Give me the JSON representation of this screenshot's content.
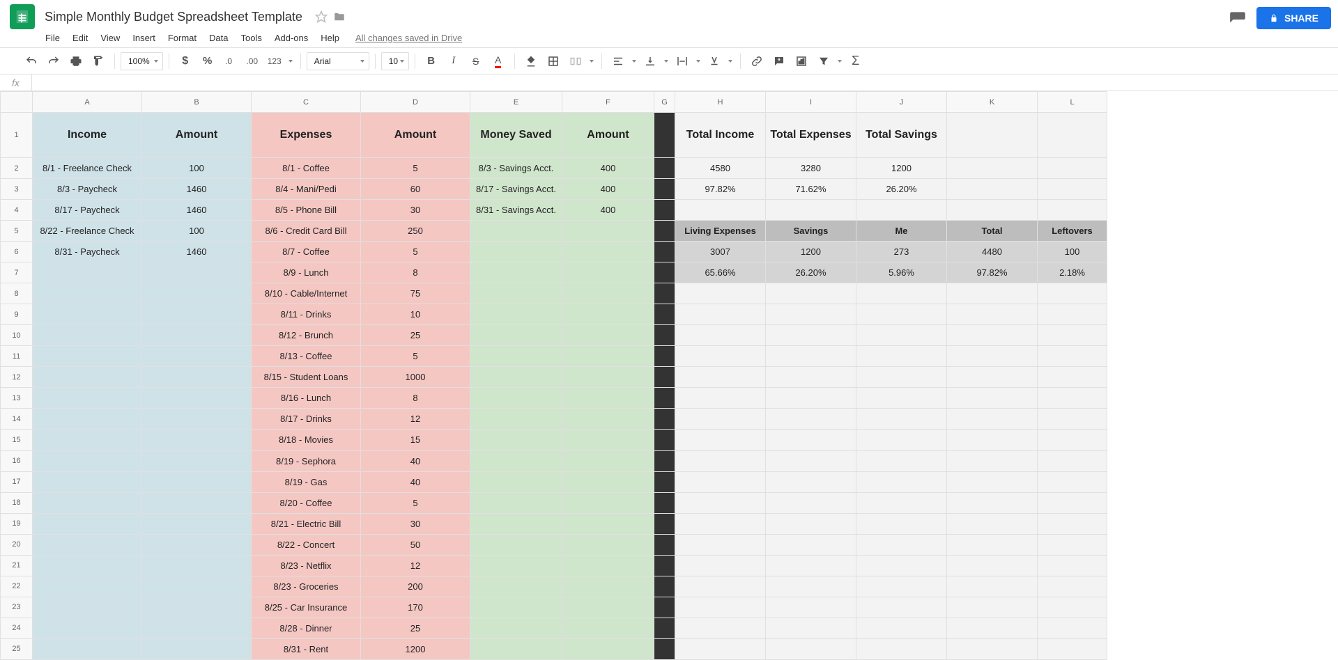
{
  "doc": {
    "title": "Simple Monthly Budget Spreadsheet Template",
    "save_status": "All changes saved in Drive"
  },
  "menu": [
    "File",
    "Edit",
    "View",
    "Insert",
    "Format",
    "Data",
    "Tools",
    "Add-ons",
    "Help"
  ],
  "toolbar": {
    "zoom": "100%",
    "font": "Arial",
    "size": "10"
  },
  "share": "SHARE",
  "cols": [
    "A",
    "B",
    "C",
    "D",
    "E",
    "F",
    "G",
    "H",
    "I",
    "J",
    "K",
    "L"
  ],
  "headers": {
    "income": "Income",
    "amount1": "Amount",
    "expenses": "Expenses",
    "amount2": "Amount",
    "saved": "Money Saved",
    "amount3": "Amount",
    "ti": "Total Income",
    "te": "Total Expenses",
    "ts": "Total Savings",
    "le": "Living Expenses",
    "sv": "Savings",
    "me": "Me",
    "tot": "Total",
    "lo": "Leftovers"
  },
  "income": [
    [
      "8/1 - Freelance Check",
      "100"
    ],
    [
      "8/3 - Paycheck",
      "1460"
    ],
    [
      "8/17 - Paycheck",
      "1460"
    ],
    [
      "8/22 - Freelance Check",
      "100"
    ],
    [
      "8/31 - Paycheck",
      "1460"
    ]
  ],
  "expenses": [
    [
      "8/1 - Coffee",
      "5"
    ],
    [
      "8/4 - Mani/Pedi",
      "60"
    ],
    [
      "8/5 - Phone Bill",
      "30"
    ],
    [
      "8/6 - Credit Card Bill",
      "250"
    ],
    [
      "8/7 - Coffee",
      "5"
    ],
    [
      "8/9 - Lunch",
      "8"
    ],
    [
      "8/10 - Cable/Internet",
      "75"
    ],
    [
      "8/11 - Drinks",
      "10"
    ],
    [
      "8/12 - Brunch",
      "25"
    ],
    [
      "8/13 - Coffee",
      "5"
    ],
    [
      "8/15 - Student Loans",
      "1000"
    ],
    [
      "8/16 - Lunch",
      "8"
    ],
    [
      "8/17 - Drinks",
      "12"
    ],
    [
      "8/18 - Movies",
      "15"
    ],
    [
      "8/19 - Sephora",
      "40"
    ],
    [
      "8/19 - Gas",
      "40"
    ],
    [
      "8/20 - Coffee",
      "5"
    ],
    [
      "8/21 - Electric Bill",
      "30"
    ],
    [
      "8/22 - Concert",
      "50"
    ],
    [
      "8/23 - Netflix",
      "12"
    ],
    [
      "8/23 - Groceries",
      "200"
    ],
    [
      "8/25 - Car Insurance",
      "170"
    ],
    [
      "8/28 - Dinner",
      "25"
    ],
    [
      "8/31 - Rent",
      "1200"
    ]
  ],
  "saved": [
    [
      "8/3 - Savings Acct.",
      "400"
    ],
    [
      "8/17 - Savings Acct.",
      "400"
    ],
    [
      "8/31 - Savings Acct.",
      "400"
    ]
  ],
  "totals": {
    "ti": "4580",
    "te": "3280",
    "ts": "1200",
    "tip": "97.82%",
    "tep": "71.62%",
    "tsp": "26.20%"
  },
  "breakdown": {
    "le": "3007",
    "sv": "1200",
    "me": "273",
    "tot": "4480",
    "lo": "100",
    "lep": "65.66%",
    "svp": "26.20%",
    "mep": "5.96%",
    "totp": "97.82%",
    "lop": "2.18%"
  }
}
